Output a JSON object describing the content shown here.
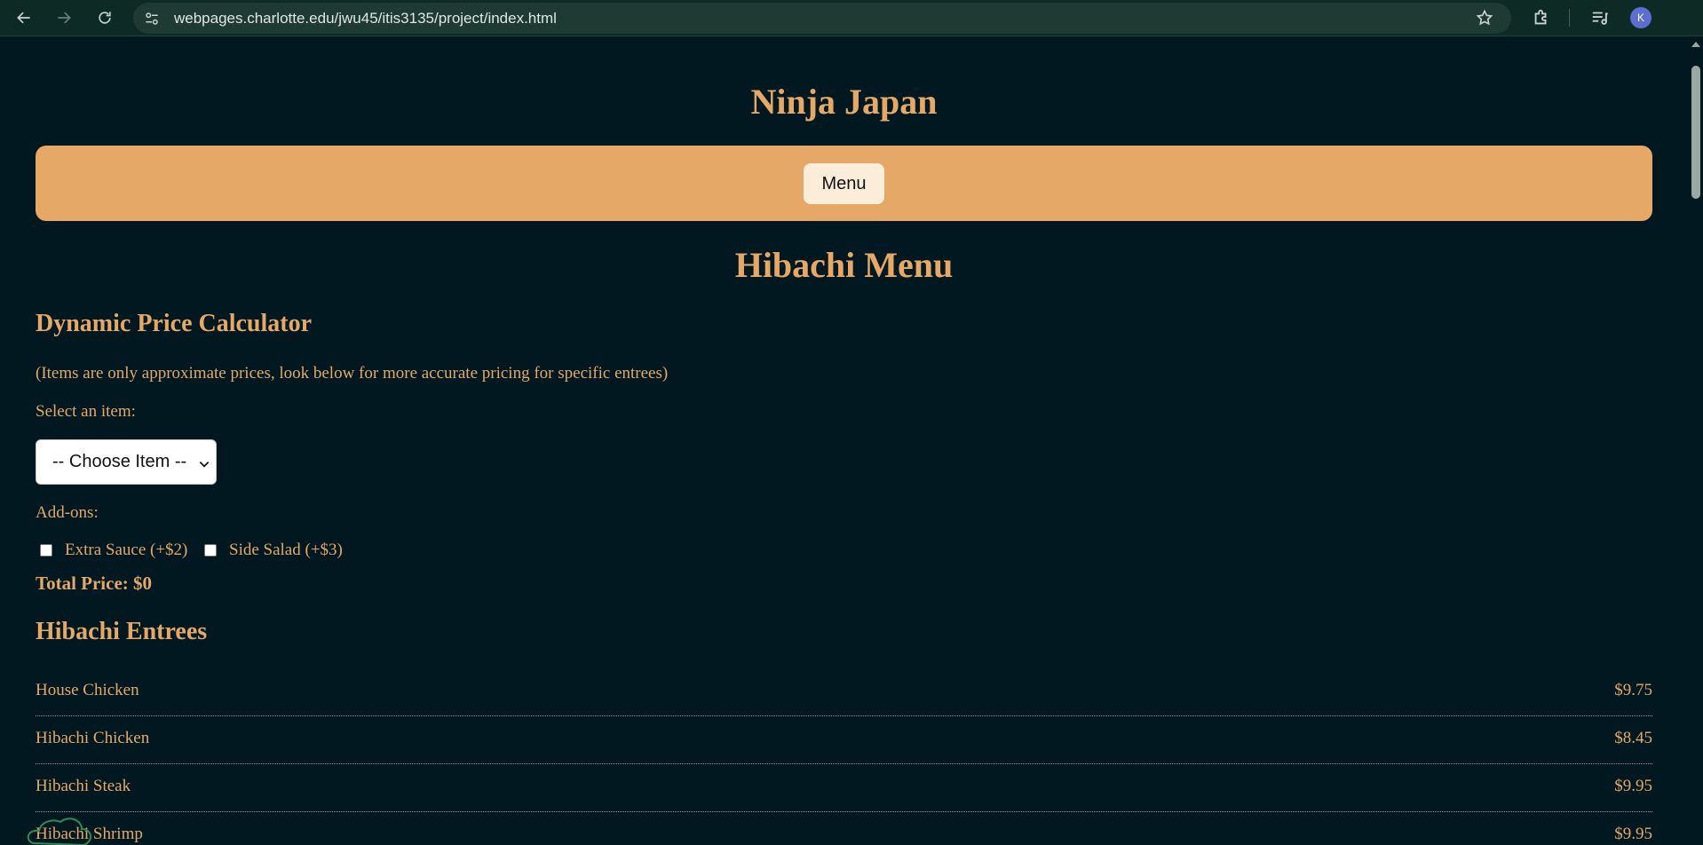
{
  "browser": {
    "url": "webpages.charlotte.edu/jwu45/itis3135/project/index.html",
    "profile_initial": "K",
    "icons": [
      "back-arrow-icon",
      "forward-arrow-icon",
      "reload-icon",
      "site-info-icon",
      "star-icon",
      "extensions-icon",
      "media-controls-icon"
    ]
  },
  "site": {
    "title": "Ninja Japan",
    "nav": {
      "menu_label": "Menu"
    }
  },
  "main": {
    "page_title": "Hibachi Menu",
    "calculator": {
      "heading": "Dynamic Price Calculator",
      "note": "(Items are only approximate prices, look below for more accurate pricing for specific entrees)",
      "select_label": "Select an item:",
      "select_value": "-- Choose Item --",
      "addons_label": "Add-ons:",
      "addons": [
        {
          "label": "Extra Sauce (+$2)",
          "checked": false
        },
        {
          "label": "Side Salad (+$3)",
          "checked": false
        }
      ],
      "total_label": "Total Price: $0"
    },
    "entrees": {
      "heading": "Hibachi Entrees",
      "items": [
        {
          "name": "House Chicken",
          "price": "$9.75"
        },
        {
          "name": "Hibachi Chicken",
          "price": "$8.45"
        },
        {
          "name": "Hibachi Steak",
          "price": "$9.95"
        },
        {
          "name": "Hibachi Shrimp",
          "price": "$9.95"
        }
      ]
    }
  },
  "colors": {
    "background": "#011820",
    "accent": "#e5a866",
    "nav_button": "#fbedd9",
    "annotation": "#2e8b57"
  }
}
